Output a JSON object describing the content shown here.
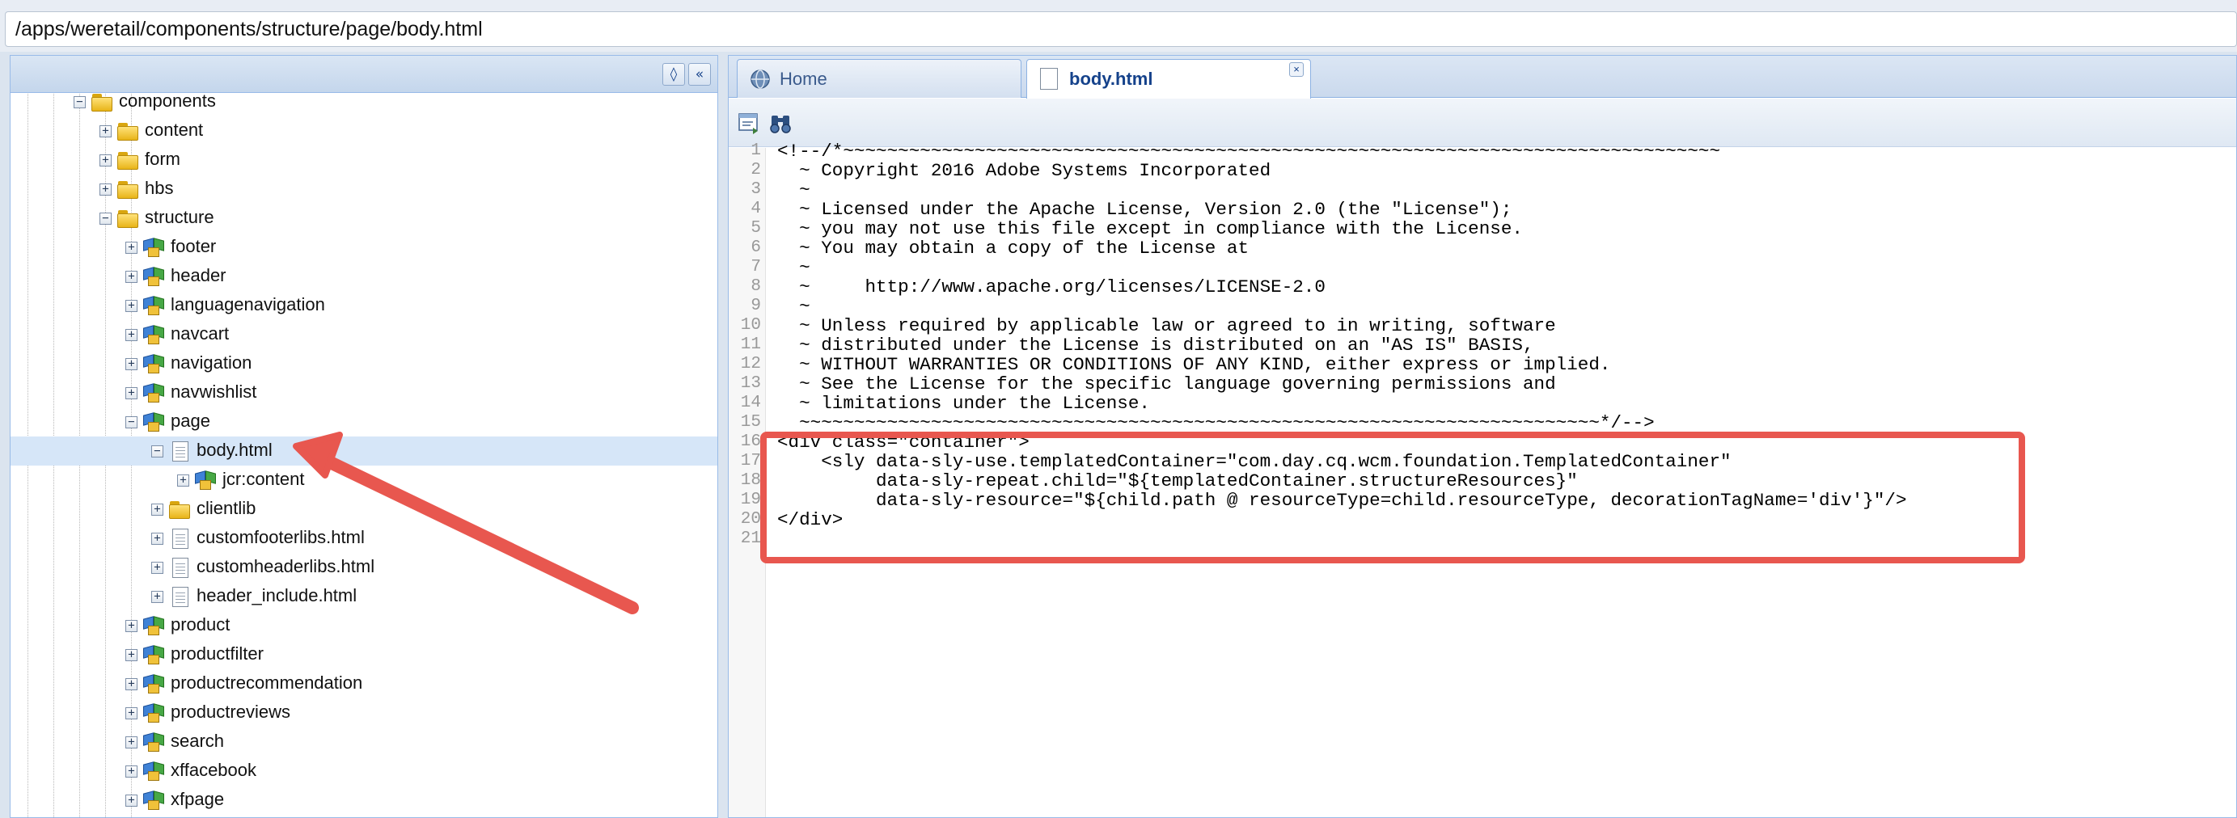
{
  "path_bar": {
    "value": "/apps/weretail/components/structure/page/body.html"
  },
  "tree": {
    "header_buttons": [
      {
        "name": "binoculars-icon",
        "glyph": "🔍"
      },
      {
        "name": "collapse-panel-icon",
        "glyph": "«"
      }
    ],
    "rows": [
      {
        "label": "components",
        "depth": 3,
        "icon": "folder-icon",
        "expander": "minus"
      },
      {
        "label": "content",
        "depth": 4,
        "icon": "folder-icon",
        "expander": "plus"
      },
      {
        "label": "form",
        "depth": 4,
        "icon": "folder-icon",
        "expander": "plus"
      },
      {
        "label": "hbs",
        "depth": 4,
        "icon": "folder-icon",
        "expander": "plus"
      },
      {
        "label": "structure",
        "depth": 4,
        "icon": "folder-icon",
        "expander": "minus"
      },
      {
        "label": "footer",
        "depth": 5,
        "icon": "component-icon",
        "expander": "plus"
      },
      {
        "label": "header",
        "depth": 5,
        "icon": "component-icon",
        "expander": "plus"
      },
      {
        "label": "languagenavigation",
        "depth": 5,
        "icon": "component-icon",
        "expander": "plus"
      },
      {
        "label": "navcart",
        "depth": 5,
        "icon": "component-icon",
        "expander": "plus"
      },
      {
        "label": "navigation",
        "depth": 5,
        "icon": "component-icon",
        "expander": "plus"
      },
      {
        "label": "navwishlist",
        "depth": 5,
        "icon": "component-icon",
        "expander": "plus"
      },
      {
        "label": "page",
        "depth": 5,
        "icon": "component-icon",
        "expander": "minus"
      },
      {
        "label": "body.html",
        "depth": 6,
        "icon": "file-icon",
        "expander": "minus",
        "selected": true
      },
      {
        "label": "jcr:content",
        "depth": 7,
        "icon": "component-icon",
        "expander": "plus"
      },
      {
        "label": "clientlib",
        "depth": 6,
        "icon": "folder-icon",
        "expander": "plus"
      },
      {
        "label": "customfooterlibs.html",
        "depth": 6,
        "icon": "file-icon",
        "expander": "plus"
      },
      {
        "label": "customheaderlibs.html",
        "depth": 6,
        "icon": "file-icon",
        "expander": "plus"
      },
      {
        "label": "header_include.html",
        "depth": 6,
        "icon": "file-icon",
        "expander": "plus"
      },
      {
        "label": "product",
        "depth": 5,
        "icon": "component-icon",
        "expander": "plus"
      },
      {
        "label": "productfilter",
        "depth": 5,
        "icon": "component-icon",
        "expander": "plus"
      },
      {
        "label": "productrecommendation",
        "depth": 5,
        "icon": "component-icon",
        "expander": "plus"
      },
      {
        "label": "productreviews",
        "depth": 5,
        "icon": "component-icon",
        "expander": "plus"
      },
      {
        "label": "search",
        "depth": 5,
        "icon": "component-icon",
        "expander": "plus"
      },
      {
        "label": "xffacebook",
        "depth": 5,
        "icon": "component-icon",
        "expander": "plus"
      },
      {
        "label": "xfpage",
        "depth": 5,
        "icon": "component-icon",
        "expander": "plus"
      }
    ]
  },
  "tabs": [
    {
      "label": "Home",
      "icon": "home-icon",
      "active": false
    },
    {
      "label": "body.html",
      "icon": "file-icon",
      "active": true,
      "close": "×"
    }
  ],
  "toolbar": {
    "buttons": [
      {
        "name": "format-code-icon",
        "glyph": "⧉"
      },
      {
        "name": "find-binoculars-icon",
        "glyph": "⚲"
      }
    ]
  },
  "editor": {
    "lines": [
      "<!--/*~~~~~~~~~~~~~~~~~~~~~~~~~~~~~~~~~~~~~~~~~~~~~~~~~~~~~~~~~~~~~~~~~~~~~~~~~~~~~~~~",
      "  ~ Copyright 2016 Adobe Systems Incorporated",
      "  ~",
      "  ~ Licensed under the Apache License, Version 2.0 (the \"License\");",
      "  ~ you may not use this file except in compliance with the License.",
      "  ~ You may obtain a copy of the License at",
      "  ~",
      "  ~     http://www.apache.org/licenses/LICENSE-2.0",
      "  ~",
      "  ~ Unless required by applicable law or agreed to in writing, software",
      "  ~ distributed under the License is distributed on an \"AS IS\" BASIS,",
      "  ~ WITHOUT WARRANTIES OR CONDITIONS OF ANY KIND, either express or implied.",
      "  ~ See the License for the specific language governing permissions and",
      "  ~ limitations under the License.",
      "  ~~~~~~~~~~~~~~~~~~~~~~~~~~~~~~~~~~~~~~~~~~~~~~~~~~~~~~~~~~~~~~~~~~~~~~~~~*/-->",
      "<div class=\"container\">",
      "    <sly data-sly-use.templatedContainer=\"com.day.cq.wcm.foundation.TemplatedContainer\"",
      "         data-sly-repeat.child=\"${templatedContainer.structureResources}\"",
      "         data-sly-resource=\"${child.path @ resourceType=child.resourceType, decorationTagName='div'}\"/>",
      "</div>",
      ""
    ]
  },
  "colors": {
    "highlight": "#e8574f",
    "selection": "#d6e6f8",
    "panel_border": "#99bbe8"
  }
}
